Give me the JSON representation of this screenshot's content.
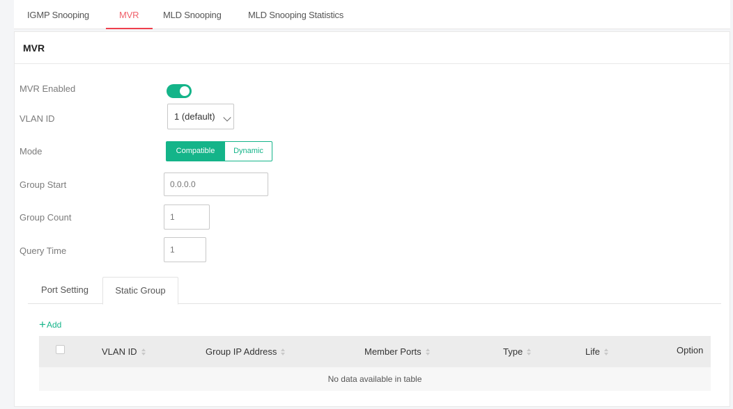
{
  "top_tabs": [
    {
      "label": "IGMP Snooping",
      "active": false
    },
    {
      "label": "MVR",
      "active": true
    },
    {
      "label": "MLD Snooping",
      "active": false
    },
    {
      "label": "MLD Snooping Statistics",
      "active": false
    }
  ],
  "section": {
    "title": "MVR"
  },
  "form": {
    "mvr_enabled": {
      "label": "MVR Enabled",
      "value": true
    },
    "vlan_id": {
      "label": "VLAN ID",
      "value": "1 (default)"
    },
    "mode": {
      "label": "Mode",
      "options": [
        "Compatible",
        "Dynamic"
      ],
      "selected": "Compatible"
    },
    "group_start": {
      "label": "Group Start",
      "placeholder": "0.0.0.0"
    },
    "group_count": {
      "label": "Group Count",
      "placeholder": "1"
    },
    "query_time": {
      "label": "Query Time",
      "placeholder": "1"
    }
  },
  "sub_tabs": [
    {
      "label": "Port Setting",
      "active": false
    },
    {
      "label": "Static Group",
      "active": true
    }
  ],
  "actions": {
    "add_label": "Add",
    "add_icon": "plus-icon"
  },
  "table": {
    "columns": [
      "VLAN ID",
      "Group IP Address",
      "Member Ports",
      "Type",
      "Life",
      "Option"
    ],
    "empty_text": "No data available in table"
  },
  "colors": {
    "accent": "#14b489",
    "active_tab": "#ef3f4c"
  }
}
